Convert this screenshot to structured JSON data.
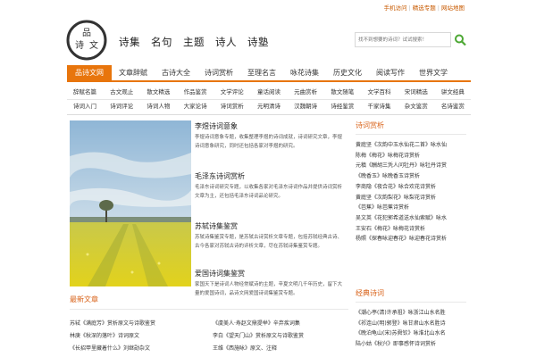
{
  "toplinks": [
    "手机访问",
    "精选专题",
    "网站地图"
  ],
  "logo": {
    "text": "品诗文"
  },
  "subnav": [
    "诗集",
    "名句",
    "主题",
    "诗人",
    "诗塾"
  ],
  "search": {
    "placeholder": "找不到想要的诗词？试试搜索！"
  },
  "mainnav": [
    "品诗文网",
    "文章辞赋",
    "古诗大全",
    "诗词赏析",
    "至理名言",
    "咏花诗集",
    "历史文化",
    "阅读写作",
    "世界文学"
  ],
  "categories": [
    [
      "辞赋名篇",
      "古文观止",
      "散文精选",
      "作品鉴赏",
      "文学评论",
      "童话阅读",
      "元曲赏析",
      "散文随笔",
      "文学百科",
      "宋词精选",
      "骈文经典"
    ],
    [
      "诗词入门",
      "诗词评论",
      "诗词人物",
      "大家论诗",
      "诗词赏析",
      "元明清诗",
      "汉魏朝诗",
      "诗经鉴赏",
      "千家诗集",
      "杂文鉴赏",
      "名诗鉴赏"
    ]
  ],
  "features": [
    {
      "title": "李煜诗词意象",
      "text": "李煜诗词意象专题，收集整理李煜的诗词成就，诗词研究文章，李煜诗词意象研究，同时还包括各家对李煜的研究。"
    },
    {
      "title": "毛泽东诗词赏析",
      "text": "毛泽东诗词研究专题，以收集各家对毛泽东诗词作品并提供诗词赏析文章为主，还包括毛泽东诗词品论研究。"
    },
    {
      "title": "苏轼诗集鉴赏",
      "text": "苏轼诗集鉴赏专题，是苏轼古诗赏析文章专题，包括苏轼经典古诗、古今各家对苏轼古诗的评析文章，尽在苏轼诗集鉴赏专题。"
    },
    {
      "title": "爱国诗词集鉴赏",
      "text": "家国天下是诗词人物经常赋诗的主题，辛夏文明几千年历史，留下大量的爱国诗词，品诗文网爱国诗词集鉴赏专题。"
    }
  ],
  "latest": {
    "heading": "最新文章",
    "items": [
      "苏轼《满庭芳》赏析原文与诗歌鉴赏",
      "《虞美人·寿赵文鼎提举》辛弃疾词集",
      "林庚《秋深的落叶》诗词原文",
      "李白《望天门山》赏析原文与诗歌鉴赏",
      "《长招甲里藏着什么》刘继勋杂文",
      "王维《西施咏》原文、注释"
    ]
  },
  "side": {
    "heading": "诗词赏析",
    "items": [
      "黄庭坚《次韵中玉水仙花二首》咏水仙",
      "陈梅《梅花》咏梅花诗赏析",
      "元稹《酬胡三凭人问牡丹》咏牡丹诗赏",
      "《晚香玉》咏晚香玉诗赏析",
      "李商隐《夜合花》咏合欢花诗赏析",
      "黄庭坚《次韵梨花》咏梨花诗赏析",
      "《芭蕉》咏芭蕉诗赏析",
      "吴文英《花犯郭希道送水仙索赋》咏水",
      "王安石《梅花》咏梅花诗赏析",
      "杨照《探春咏迎春花》咏迎春花诗赏析"
    ]
  },
  "side2": {
    "heading": "经典诗词",
    "items": [
      "《潮心亭(清)许承祖》咏浙江山水名胜",
      "《祁连山(明)郭登》咏甘肃山水名胜诗",
      "《晚泊龟山(宋)苏舜钦》咏淮北山水名",
      "陆小姑《秋兴》即事感怀诗词赏析"
    ]
  },
  "colors": {
    "accent": "#e8750c",
    "heading": "#d9631a",
    "link": "#c85a00"
  }
}
